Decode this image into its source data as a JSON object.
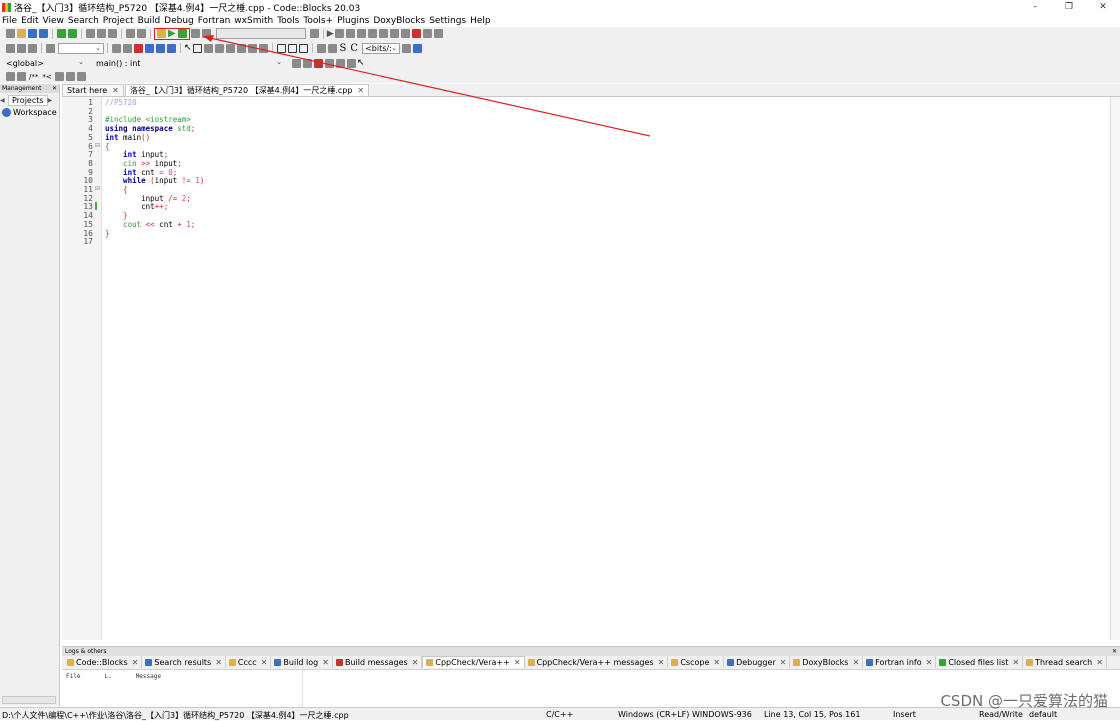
{
  "window": {
    "title": "洛谷_【入门3】循环结构_P5720 【深基4.例4】一尺之棰.cpp - Code::Blocks 20.03",
    "controls": [
      "minimize-icon",
      "maximize-icon",
      "close-icon"
    ]
  },
  "menu": [
    "File",
    "Edit",
    "View",
    "Search",
    "Project",
    "Build",
    "Debug",
    "Fortran",
    "wxSmith",
    "Tools",
    "Tools+",
    "Plugins",
    "DoxyBlocks",
    "Settings",
    "Help"
  ],
  "toolbar": {
    "scope_combo": "<global>",
    "function_combo": "main() : int",
    "bits_combo": "<bits/:",
    "highlighted_group": [
      "build-icon",
      "run-icon",
      "build-and-run-icon"
    ],
    "annotation_color": "#e02020"
  },
  "management": {
    "header": "Management",
    "tab": "Projects",
    "tree_root": "Workspace"
  },
  "editor": {
    "tabs": [
      {
        "label": "Start here",
        "active": false
      },
      {
        "label": "洛谷_【入门3】循环结构_P5720 【深基4.例4】一尺之棰.cpp",
        "active": true
      }
    ],
    "line_numbers": [
      "1",
      "2",
      "3",
      "4",
      "5",
      "6",
      "7",
      "8",
      "9",
      "10",
      "11",
      "12",
      "13",
      "14",
      "15",
      "16",
      "17"
    ],
    "lines": [
      {
        "n": 1,
        "tokens": [
          {
            "t": "//P5720",
            "c": "cmt"
          }
        ]
      },
      {
        "n": 2,
        "tokens": []
      },
      {
        "n": 3,
        "tokens": [
          {
            "t": "#include <iostream>",
            "c": "pp"
          }
        ]
      },
      {
        "n": 4,
        "tokens": [
          {
            "t": "using namespace",
            "c": "kw"
          },
          {
            "t": " std",
            "c": "pp"
          },
          {
            "t": ";",
            "c": "op"
          }
        ]
      },
      {
        "n": 5,
        "tokens": [
          {
            "t": "int",
            "c": "ty"
          },
          {
            "t": " main",
            "c": "id"
          },
          {
            "t": "()",
            "c": "op"
          }
        ]
      },
      {
        "n": 6,
        "tokens": [
          {
            "t": "{",
            "c": "op"
          }
        ]
      },
      {
        "n": 7,
        "tokens": [
          {
            "t": "    int",
            "c": "ty"
          },
          {
            "t": " input",
            "c": "id"
          },
          {
            "t": ";",
            "c": "op"
          }
        ]
      },
      {
        "n": 8,
        "tokens": [
          {
            "t": "    cin",
            "c": "pp"
          },
          {
            "t": " >>",
            "c": "op"
          },
          {
            "t": " input",
            "c": "id"
          },
          {
            "t": ";",
            "c": "op"
          }
        ]
      },
      {
        "n": 9,
        "tokens": [
          {
            "t": "    int",
            "c": "ty"
          },
          {
            "t": " cnt ",
            "c": "id"
          },
          {
            "t": "=",
            "c": "op"
          },
          {
            "t": " 0",
            "c": "num"
          },
          {
            "t": ";",
            "c": "op"
          }
        ]
      },
      {
        "n": 10,
        "tokens": [
          {
            "t": "    while",
            "c": "kw"
          },
          {
            "t": " (",
            "c": "op"
          },
          {
            "t": "input ",
            "c": "id"
          },
          {
            "t": "!=",
            "c": "op"
          },
          {
            "t": " 1",
            "c": "num"
          },
          {
            "t": ")",
            "c": "op"
          }
        ]
      },
      {
        "n": 11,
        "tokens": [
          {
            "t": "    {",
            "c": "op"
          }
        ]
      },
      {
        "n": 12,
        "tokens": [
          {
            "t": "        input ",
            "c": "id"
          },
          {
            "t": "/=",
            "c": "op"
          },
          {
            "t": " 2",
            "c": "num"
          },
          {
            "t": ";",
            "c": "op"
          }
        ]
      },
      {
        "n": 13,
        "tokens": [
          {
            "t": "        cnt",
            "c": "id"
          },
          {
            "t": "++;",
            "c": "op"
          }
        ]
      },
      {
        "n": 14,
        "tokens": [
          {
            "t": "    }",
            "c": "op"
          }
        ]
      },
      {
        "n": 15,
        "tokens": [
          {
            "t": "    cout",
            "c": "pp"
          },
          {
            "t": " <<",
            "c": "op"
          },
          {
            "t": " cnt ",
            "c": "id"
          },
          {
            "t": "+",
            "c": "op"
          },
          {
            "t": " 1",
            "c": "num"
          },
          {
            "t": ";",
            "c": "op"
          }
        ]
      },
      {
        "n": 16,
        "tokens": [
          {
            "t": "}",
            "c": "op"
          }
        ]
      },
      {
        "n": 17,
        "tokens": []
      }
    ]
  },
  "logs": {
    "header": "Logs & others",
    "tabs": [
      {
        "label": "Code::Blocks",
        "icon": "document-icon",
        "color": "#d9b24a"
      },
      {
        "label": "Search results",
        "icon": "search-icon",
        "color": "#3a6fc4"
      },
      {
        "label": "Cccc",
        "icon": "document-icon",
        "color": "#d9b24a"
      },
      {
        "label": "Build log",
        "icon": "gear-icon",
        "color": "#3a6fc4"
      },
      {
        "label": "Build messages",
        "icon": "pin-icon",
        "color": "#c83232"
      },
      {
        "label": "CppCheck/Vera++",
        "icon": "document-icon",
        "color": "#d9b24a"
      },
      {
        "label": "CppCheck/Vera++ messages",
        "icon": "document-icon",
        "color": "#d9b24a"
      },
      {
        "label": "Cscope",
        "icon": "document-icon",
        "color": "#d9b24a"
      },
      {
        "label": "Debugger",
        "icon": "gear-icon",
        "color": "#3a6fc4"
      },
      {
        "label": "DoxyBlocks",
        "icon": "document-icon",
        "color": "#d9b24a"
      },
      {
        "label": "Fortran info",
        "icon": "fortran-icon",
        "color": "#3a6fc4"
      },
      {
        "label": "Closed files list",
        "icon": "files-icon",
        "color": "#3aa03a"
      },
      {
        "label": "Thread search",
        "icon": "document-icon",
        "color": "#d9b24a"
      }
    ],
    "active_tab": 5,
    "columns": [
      "File",
      "L.",
      "Message"
    ]
  },
  "status": {
    "path": "D:\\个人文件\\编程\\C++\\作业\\洛谷\\洛谷_【入门3】循环结构_P5720 【深基4.例4】一尺之棰.cpp",
    "lang": "C/C++",
    "eol": "Windows (CR+LF)",
    "encoding": "WINDOWS-936",
    "position": "Line 13, Col 15, Pos 161",
    "mode": "Insert",
    "access": "Read/Write",
    "profile": "default"
  },
  "watermark": "CSDN @一只爱算法的猫"
}
